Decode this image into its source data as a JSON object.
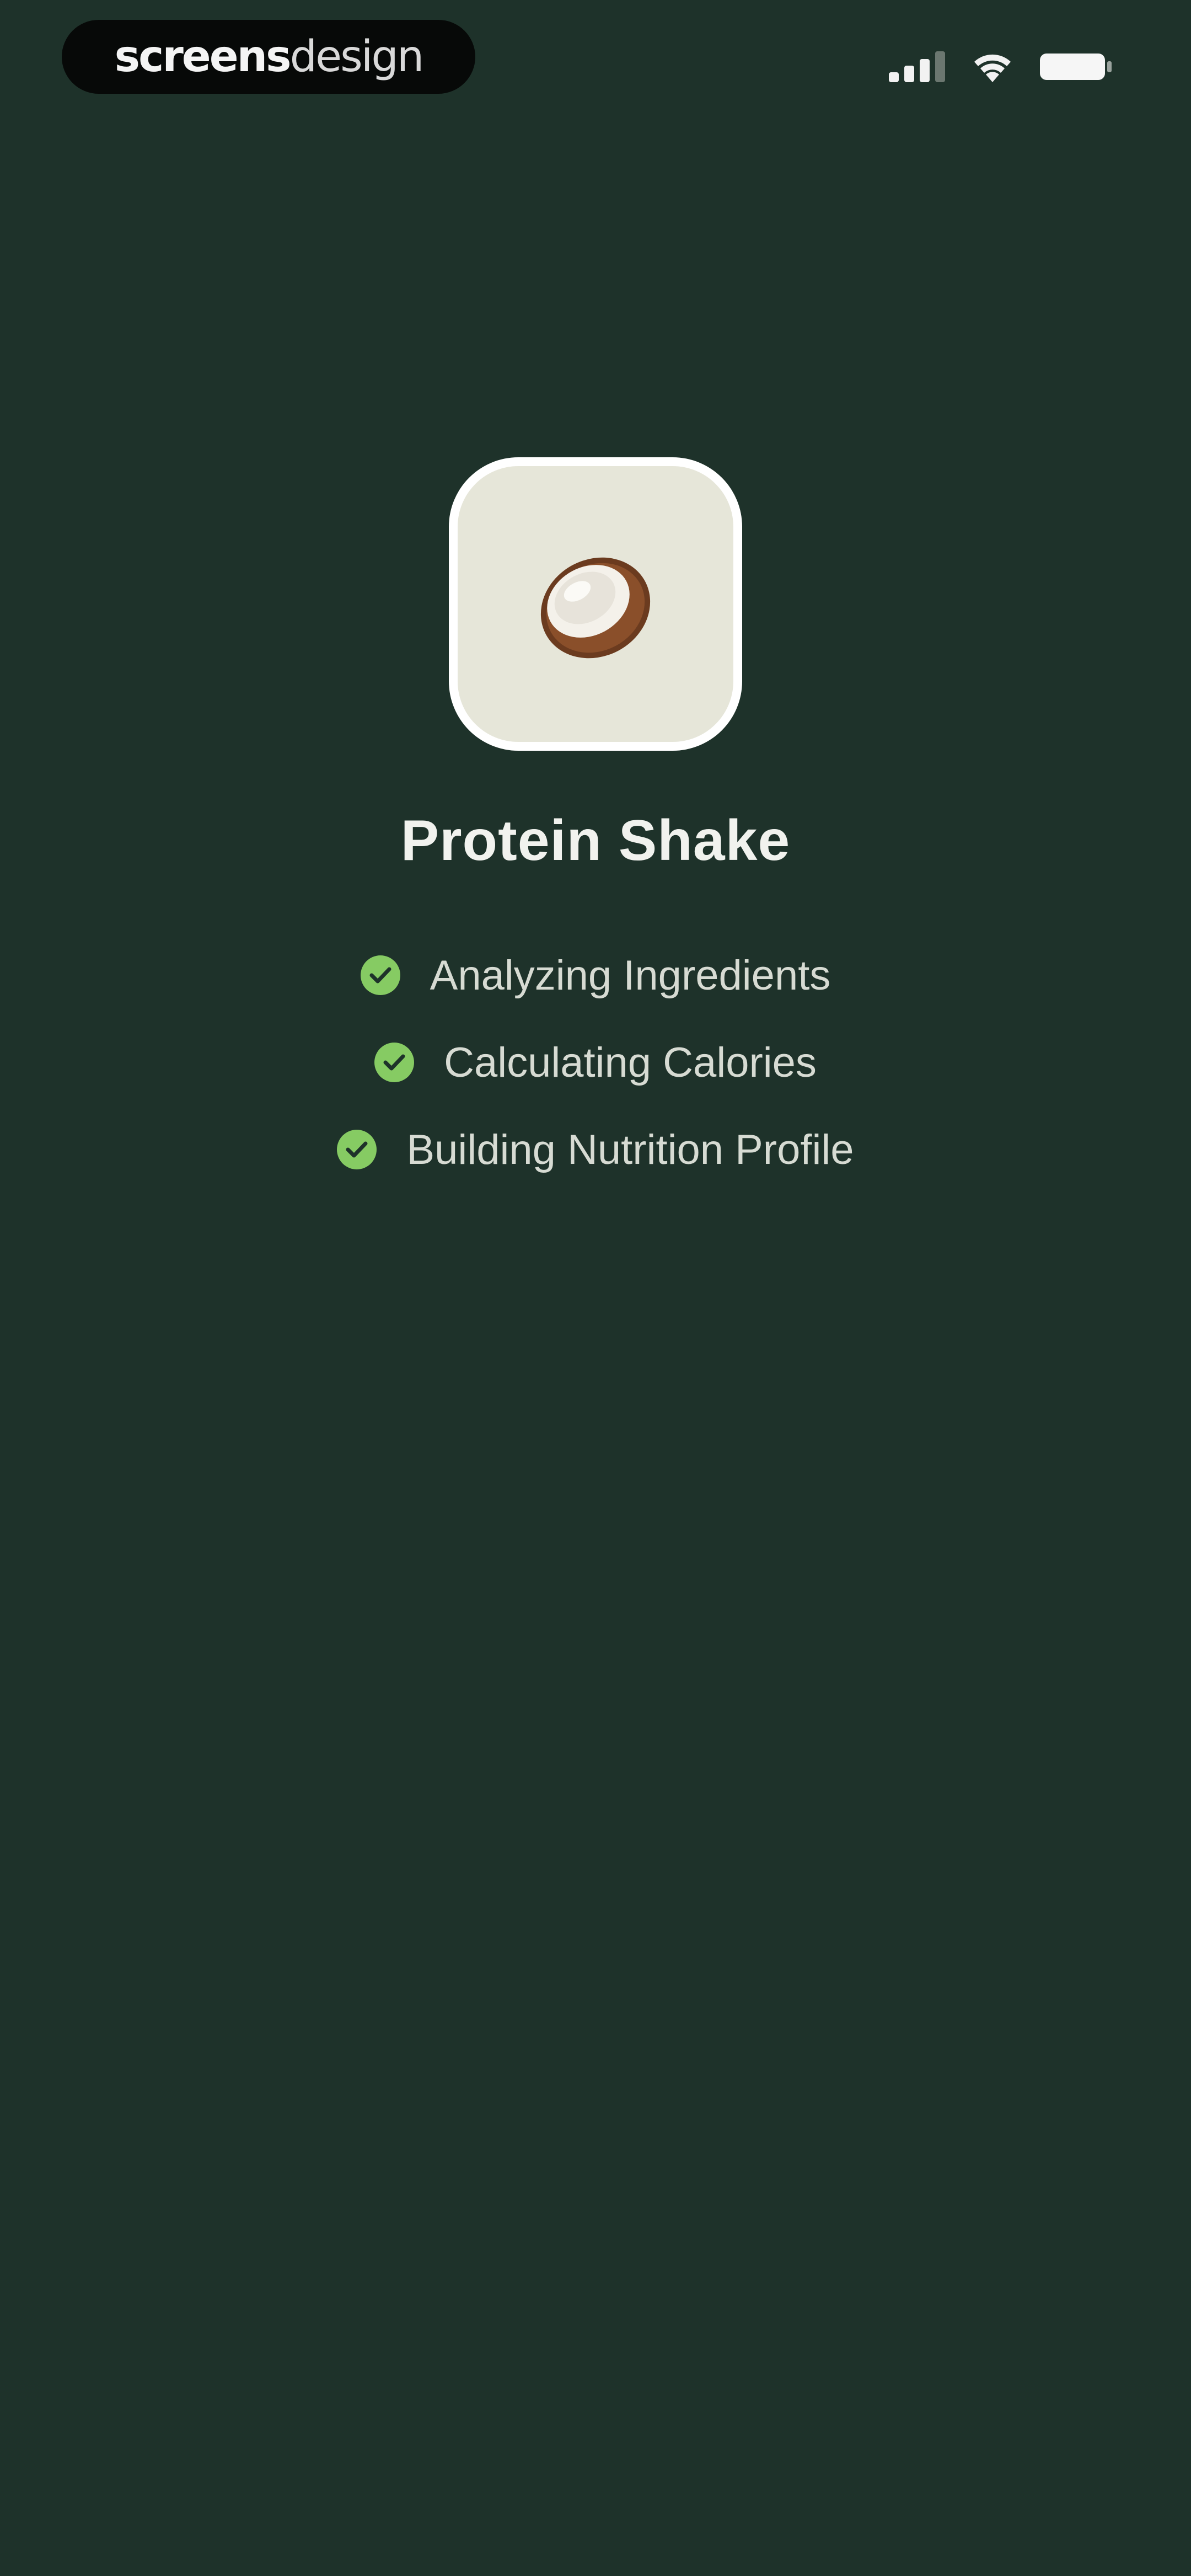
{
  "status_bar": {
    "brand": {
      "strong": "screens",
      "light": "design"
    },
    "icons": [
      "signal-icon",
      "wifi-icon",
      "battery-icon"
    ]
  },
  "item": {
    "icon": "coconut-icon",
    "name": "Protein Shake"
  },
  "steps": [
    {
      "label": "Analyzing Ingredients",
      "status": "complete",
      "icon": "check-icon"
    },
    {
      "label": "Calculating Calories",
      "status": "complete",
      "icon": "check-icon"
    },
    {
      "label": "Building Nutrition Profile",
      "status": "complete",
      "icon": "check-icon"
    }
  ],
  "colors": {
    "background": "#1e322a",
    "tile": "#e6e6d9",
    "check": "#86cb63",
    "text": "#eef0ea"
  }
}
